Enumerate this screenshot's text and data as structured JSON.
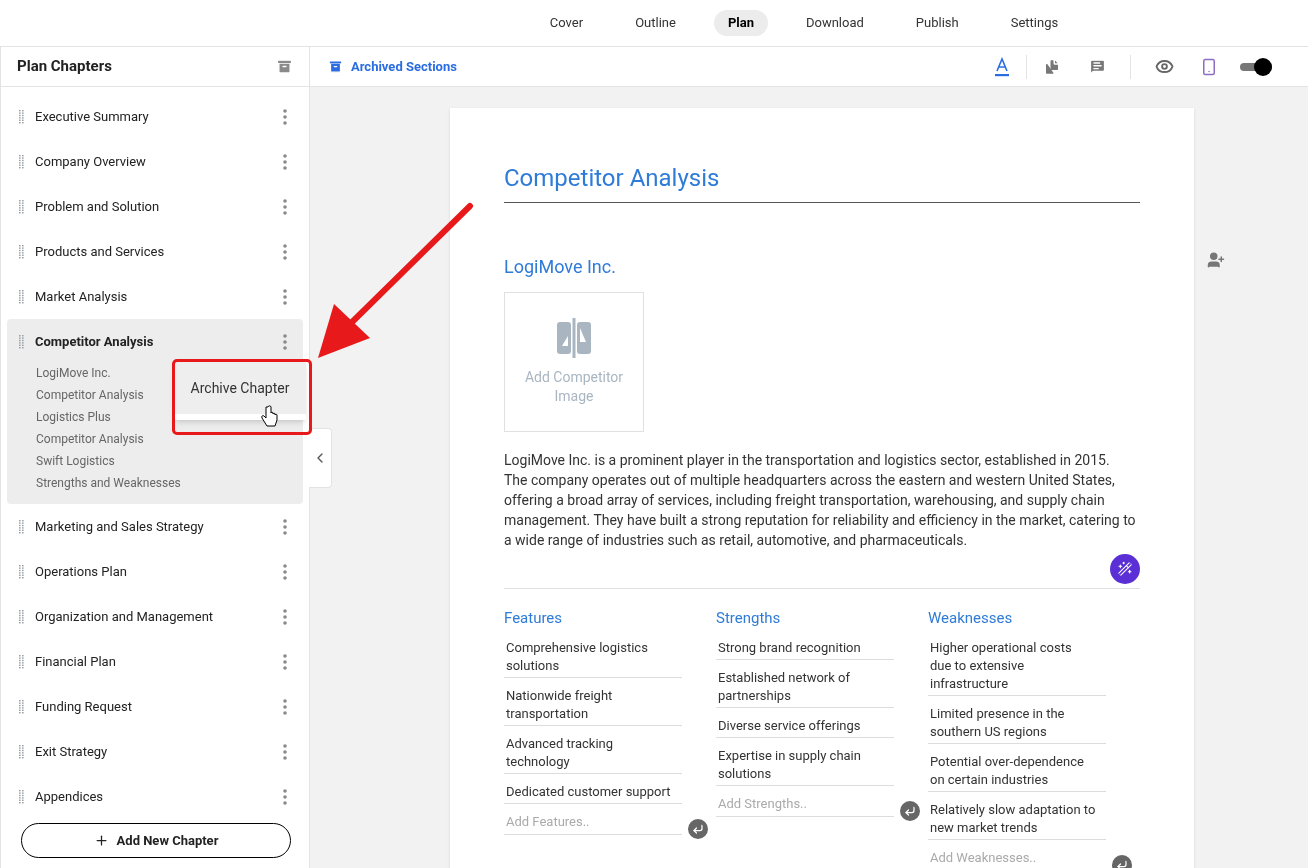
{
  "nav_tabs": [
    {
      "label": "Cover",
      "selected": false
    },
    {
      "label": "Outline",
      "selected": false
    },
    {
      "label": "Plan",
      "selected": true
    },
    {
      "label": "Download",
      "selected": false
    },
    {
      "label": "Publish",
      "selected": false
    },
    {
      "label": "Settings",
      "selected": false
    }
  ],
  "sidebar": {
    "title": "Plan Chapters",
    "chapters": [
      {
        "label": "Executive Summary",
        "selected": false,
        "expanded": false
      },
      {
        "label": "Company Overview",
        "selected": false,
        "expanded": false
      },
      {
        "label": "Problem and Solution",
        "selected": false,
        "expanded": false
      },
      {
        "label": "Products and Services",
        "selected": false,
        "expanded": false
      },
      {
        "label": "Market Analysis",
        "selected": false,
        "expanded": false
      },
      {
        "label": "Competitor Analysis",
        "selected": true,
        "expanded": true,
        "children": [
          {
            "label": "LogiMove Inc."
          },
          {
            "label": "Competitor Analysis"
          },
          {
            "label": "Logistics Plus"
          },
          {
            "label": "Competitor Analysis"
          },
          {
            "label": "Swift Logistics"
          },
          {
            "label": "Strengths and Weaknesses"
          }
        ]
      },
      {
        "label": "Marketing and Sales Strategy",
        "selected": false,
        "expanded": false
      },
      {
        "label": "Operations Plan",
        "selected": false,
        "expanded": false
      },
      {
        "label": "Organization and Management",
        "selected": false,
        "expanded": false
      },
      {
        "label": "Financial Plan",
        "selected": false,
        "expanded": false
      },
      {
        "label": "Funding Request",
        "selected": false,
        "expanded": false
      },
      {
        "label": "Exit Strategy",
        "selected": false,
        "expanded": false
      },
      {
        "label": "Appendices",
        "selected": false,
        "expanded": false
      }
    ],
    "add_button": "Add New Chapter"
  },
  "context_menu": {
    "items": [
      "Archive Chapter"
    ]
  },
  "toolbar": {
    "archived_link": "Archived Sections",
    "toggle": {
      "on": true
    }
  },
  "document": {
    "title": "Competitor Analysis",
    "competitor": "LogiMove Inc.",
    "image_placeholder": "Add Competitor Image",
    "description": "LogiMove Inc. is a prominent player in the transportation and logistics sector, established in 2015. The company operates out of multiple headquarters across the eastern and western United States, offering a broad array of services, including freight transportation, warehousing, and supply chain management. They have built a strong reputation for reliability and efficiency in the market, catering to a wide range of industries such as retail, automotive, and pharmaceuticals.",
    "columns": [
      {
        "heading": "Features",
        "items": [
          "Comprehensive logistics solutions",
          "Nationwide freight transportation",
          "Advanced tracking technology",
          "Dedicated customer support"
        ],
        "placeholder": "Add Features.."
      },
      {
        "heading": "Strengths",
        "items": [
          "Strong brand recognition",
          "Established network of partnerships",
          "Diverse service offerings",
          "Expertise in supply chain solutions"
        ],
        "placeholder": "Add Strengths.."
      },
      {
        "heading": "Weaknesses",
        "items": [
          "Higher operational costs due to extensive infrastructure",
          "Limited presence in the southern US regions",
          "Potential over-dependence on certain industries",
          "Relatively slow adaptation to new market trends"
        ],
        "placeholder": "Add Weaknesses.."
      }
    ]
  }
}
